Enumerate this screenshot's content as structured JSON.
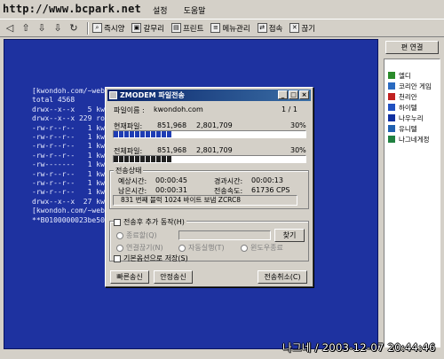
{
  "watermark": "http://www.bcpark.net",
  "menu": [
    "설정",
    "도움말"
  ],
  "toolbar": {
    "arrows": [
      "◁",
      "⇧",
      "⇩",
      "⇩",
      "↻"
    ],
    "buttons": [
      "즉시양",
      "갈무리",
      "프린트",
      "메뉴관리",
      "접속",
      "끊기"
    ]
  },
  "terminal": {
    "lines": [
      "[kwondoh.com/~web/",
      "total 4568",
      "drwx--x--x   5 kw",
      "drwx--x--x 229 ro",
      "-rw-r--r--   1 kw",
      "-rw-r--r--   1 kw",
      "-rw-r--r--   1 kw",
      "-rw-r--r--   1 kw",
      "-rw-------   1 kw",
      "-rw-r--r--   1 kw",
      "-rw-r--r--   1 kw",
      "-rw-r--r--   1 kw",
      "drwx--x--x  27 kw",
      "[kwondoh.com/~web/",
      "**B0100000023be50"
    ]
  },
  "right_panel": {
    "header_button": "편 연결",
    "items": [
      {
        "label": "엘디",
        "icon": "green-dot-icon",
        "color": "#2a8a2a"
      },
      {
        "label": "코리안 게임",
        "icon": "globe-icon",
        "color": "#2a6ac0"
      },
      {
        "label": "천리안",
        "icon": "chollian-icon",
        "color": "#c02020"
      },
      {
        "label": "하이텔",
        "icon": "hitel-icon",
        "color": "#2050c0"
      },
      {
        "label": "나우누리",
        "icon": "nownuri-icon",
        "color": "#1030a0"
      },
      {
        "label": "유니텔",
        "icon": "unitel-icon",
        "color": "#2060b0"
      },
      {
        "label": "나그네게정",
        "icon": "user-icon",
        "color": "#208040"
      }
    ]
  },
  "dialog": {
    "title": "ZMODEM 파일전송",
    "file_name_label": "파일이름 :",
    "file_name_value": "kwondoh.com",
    "file_count": "1 /  1",
    "current": {
      "label": "현재파일:",
      "done": "851,968",
      "total": "2,801,709",
      "percent": "30%",
      "progress": 0.3
    },
    "all": {
      "label": "전체파일:",
      "done": "851,968",
      "total": "2,801,709",
      "percent": "30%",
      "progress": 0.3
    },
    "status": {
      "group_title": "전송상태",
      "expected_label": "예상시간:",
      "expected_value": "00:00:45",
      "elapsed_label": "경과시간:",
      "elapsed_value": "00:00:13",
      "remaining_label": "남은시간:",
      "remaining_value": "00:00:31",
      "speed_label": "전송속도:",
      "speed_value": "61736 CPS",
      "message": "831 번째 블럭 1024 바이트 보냄 ZCRC8"
    },
    "after": {
      "group_title": "전송후 추가 동작(H)",
      "option_shutdown": "종료할(Q)",
      "option_find": "찾기",
      "radio_disconnect": "연결끊기(N)",
      "radio_auto": "자동실행(T)",
      "radio_windows": "윈도우종료",
      "save_default": "기본옵션으로 저장(S)"
    },
    "buttons": {
      "fast": "빠른송신",
      "safe": "안정송신",
      "cancel": "전송취소(C)"
    }
  },
  "footer": "나그네 / 2003-12-07 20:44:46"
}
